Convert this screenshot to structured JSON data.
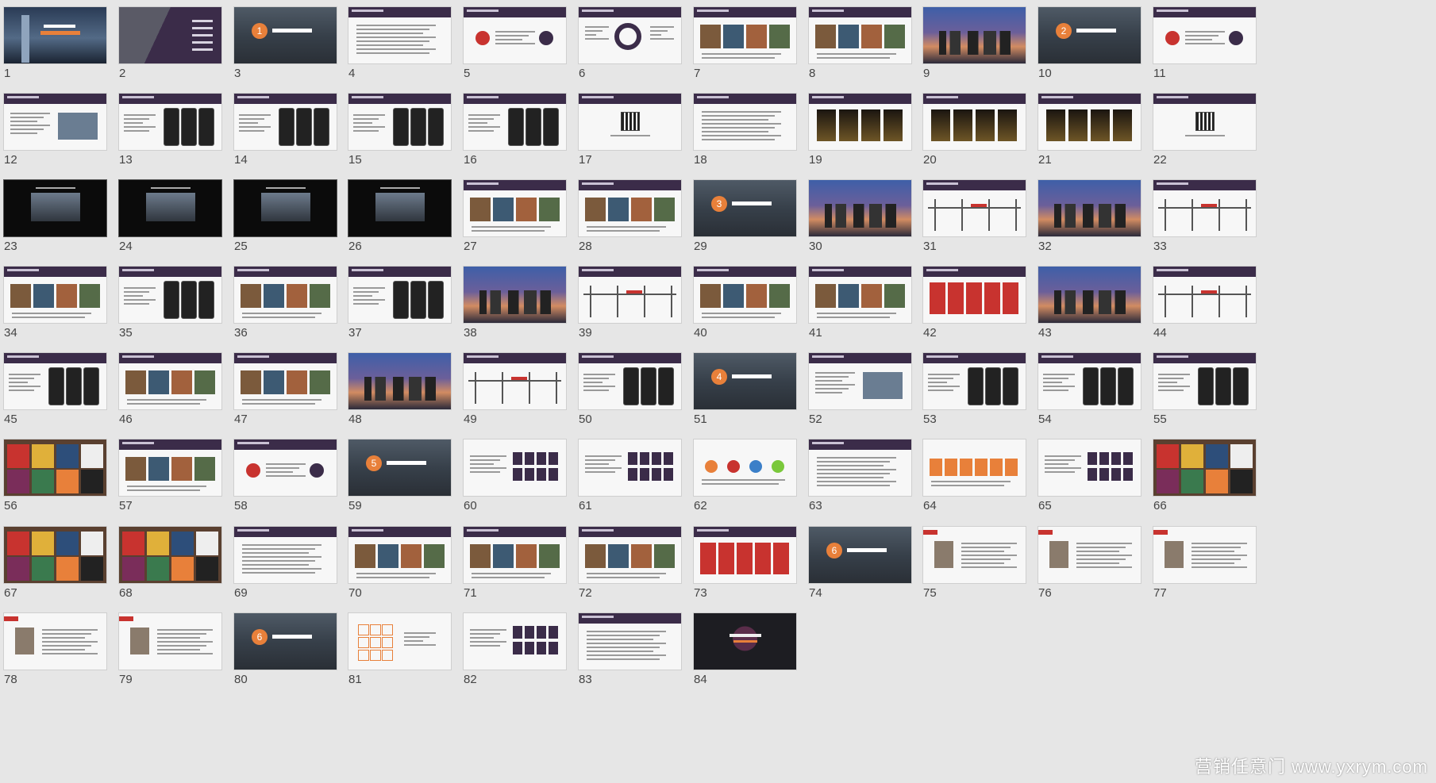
{
  "slides": [
    {
      "n": "1",
      "type": "cover"
    },
    {
      "n": "2",
      "type": "agenda"
    },
    {
      "n": "3",
      "type": "section"
    },
    {
      "n": "4",
      "type": "text"
    },
    {
      "n": "5",
      "type": "diagram"
    },
    {
      "n": "6",
      "type": "target"
    },
    {
      "n": "7",
      "type": "photos"
    },
    {
      "n": "8",
      "type": "photos"
    },
    {
      "n": "9",
      "type": "city"
    },
    {
      "n": "10",
      "type": "section"
    },
    {
      "n": "11",
      "type": "diagram"
    },
    {
      "n": "12",
      "type": "mixed"
    },
    {
      "n": "13",
      "type": "phones"
    },
    {
      "n": "14",
      "type": "phones"
    },
    {
      "n": "15",
      "type": "phones"
    },
    {
      "n": "16",
      "type": "phones"
    },
    {
      "n": "17",
      "type": "qr"
    },
    {
      "n": "18",
      "type": "text"
    },
    {
      "n": "19",
      "type": "goldcards"
    },
    {
      "n": "20",
      "type": "goldcards"
    },
    {
      "n": "21",
      "type": "goldcards"
    },
    {
      "n": "22",
      "type": "qr"
    },
    {
      "n": "23",
      "type": "black"
    },
    {
      "n": "24",
      "type": "black"
    },
    {
      "n": "25",
      "type": "black"
    },
    {
      "n": "26",
      "type": "black"
    },
    {
      "n": "27",
      "type": "photos"
    },
    {
      "n": "28",
      "type": "photos"
    },
    {
      "n": "29",
      "type": "section"
    },
    {
      "n": "30",
      "type": "city"
    },
    {
      "n": "31",
      "type": "timeline"
    },
    {
      "n": "32",
      "type": "city"
    },
    {
      "n": "33",
      "type": "timeline"
    },
    {
      "n": "34",
      "type": "photos"
    },
    {
      "n": "35",
      "type": "phones"
    },
    {
      "n": "36",
      "type": "photos"
    },
    {
      "n": "37",
      "type": "phones"
    },
    {
      "n": "38",
      "type": "city"
    },
    {
      "n": "39",
      "type": "timeline"
    },
    {
      "n": "40",
      "type": "photos"
    },
    {
      "n": "41",
      "type": "photos"
    },
    {
      "n": "42",
      "type": "redcards"
    },
    {
      "n": "43",
      "type": "city"
    },
    {
      "n": "44",
      "type": "timeline"
    },
    {
      "n": "45",
      "type": "phones"
    },
    {
      "n": "46",
      "type": "photos"
    },
    {
      "n": "47",
      "type": "photos"
    },
    {
      "n": "48",
      "type": "city"
    },
    {
      "n": "49",
      "type": "timeline"
    },
    {
      "n": "50",
      "type": "phones"
    },
    {
      "n": "51",
      "type": "section"
    },
    {
      "n": "52",
      "type": "mixed"
    },
    {
      "n": "53",
      "type": "phones"
    },
    {
      "n": "54",
      "type": "phones"
    },
    {
      "n": "55",
      "type": "phones"
    },
    {
      "n": "56",
      "type": "posters"
    },
    {
      "n": "57",
      "type": "photos"
    },
    {
      "n": "58",
      "type": "diagram"
    },
    {
      "n": "59",
      "type": "section"
    },
    {
      "n": "60",
      "type": "grid"
    },
    {
      "n": "61",
      "type": "grid"
    },
    {
      "n": "62",
      "type": "circles"
    },
    {
      "n": "63",
      "type": "text"
    },
    {
      "n": "64",
      "type": "orangeboxes"
    },
    {
      "n": "65",
      "type": "grid"
    },
    {
      "n": "66",
      "type": "posters"
    },
    {
      "n": "67",
      "type": "posters"
    },
    {
      "n": "68",
      "type": "posters"
    },
    {
      "n": "69",
      "type": "text"
    },
    {
      "n": "70",
      "type": "photos"
    },
    {
      "n": "71",
      "type": "photos"
    },
    {
      "n": "72",
      "type": "photos"
    },
    {
      "n": "73",
      "type": "redcards"
    },
    {
      "n": "74",
      "type": "section"
    },
    {
      "n": "75",
      "type": "profile"
    },
    {
      "n": "76",
      "type": "profile"
    },
    {
      "n": "77",
      "type": "profile"
    },
    {
      "n": "78",
      "type": "profile"
    },
    {
      "n": "79",
      "type": "profile"
    },
    {
      "n": "80",
      "type": "section"
    },
    {
      "n": "81",
      "type": "orangegrid"
    },
    {
      "n": "82",
      "type": "grid"
    },
    {
      "n": "83",
      "type": "text"
    },
    {
      "n": "84",
      "type": "thanks"
    }
  ],
  "section_numbers": {
    "3": "1",
    "10": "2",
    "29": "3",
    "51": "4",
    "59": "5",
    "74": "6",
    "80": "6"
  },
  "watermark": "营销任意门 www.yxrym.com",
  "colors": {
    "header": "#3b2c49",
    "accent": "#e8803a",
    "red": "#c8332f",
    "bg": "#e6e6e6"
  }
}
